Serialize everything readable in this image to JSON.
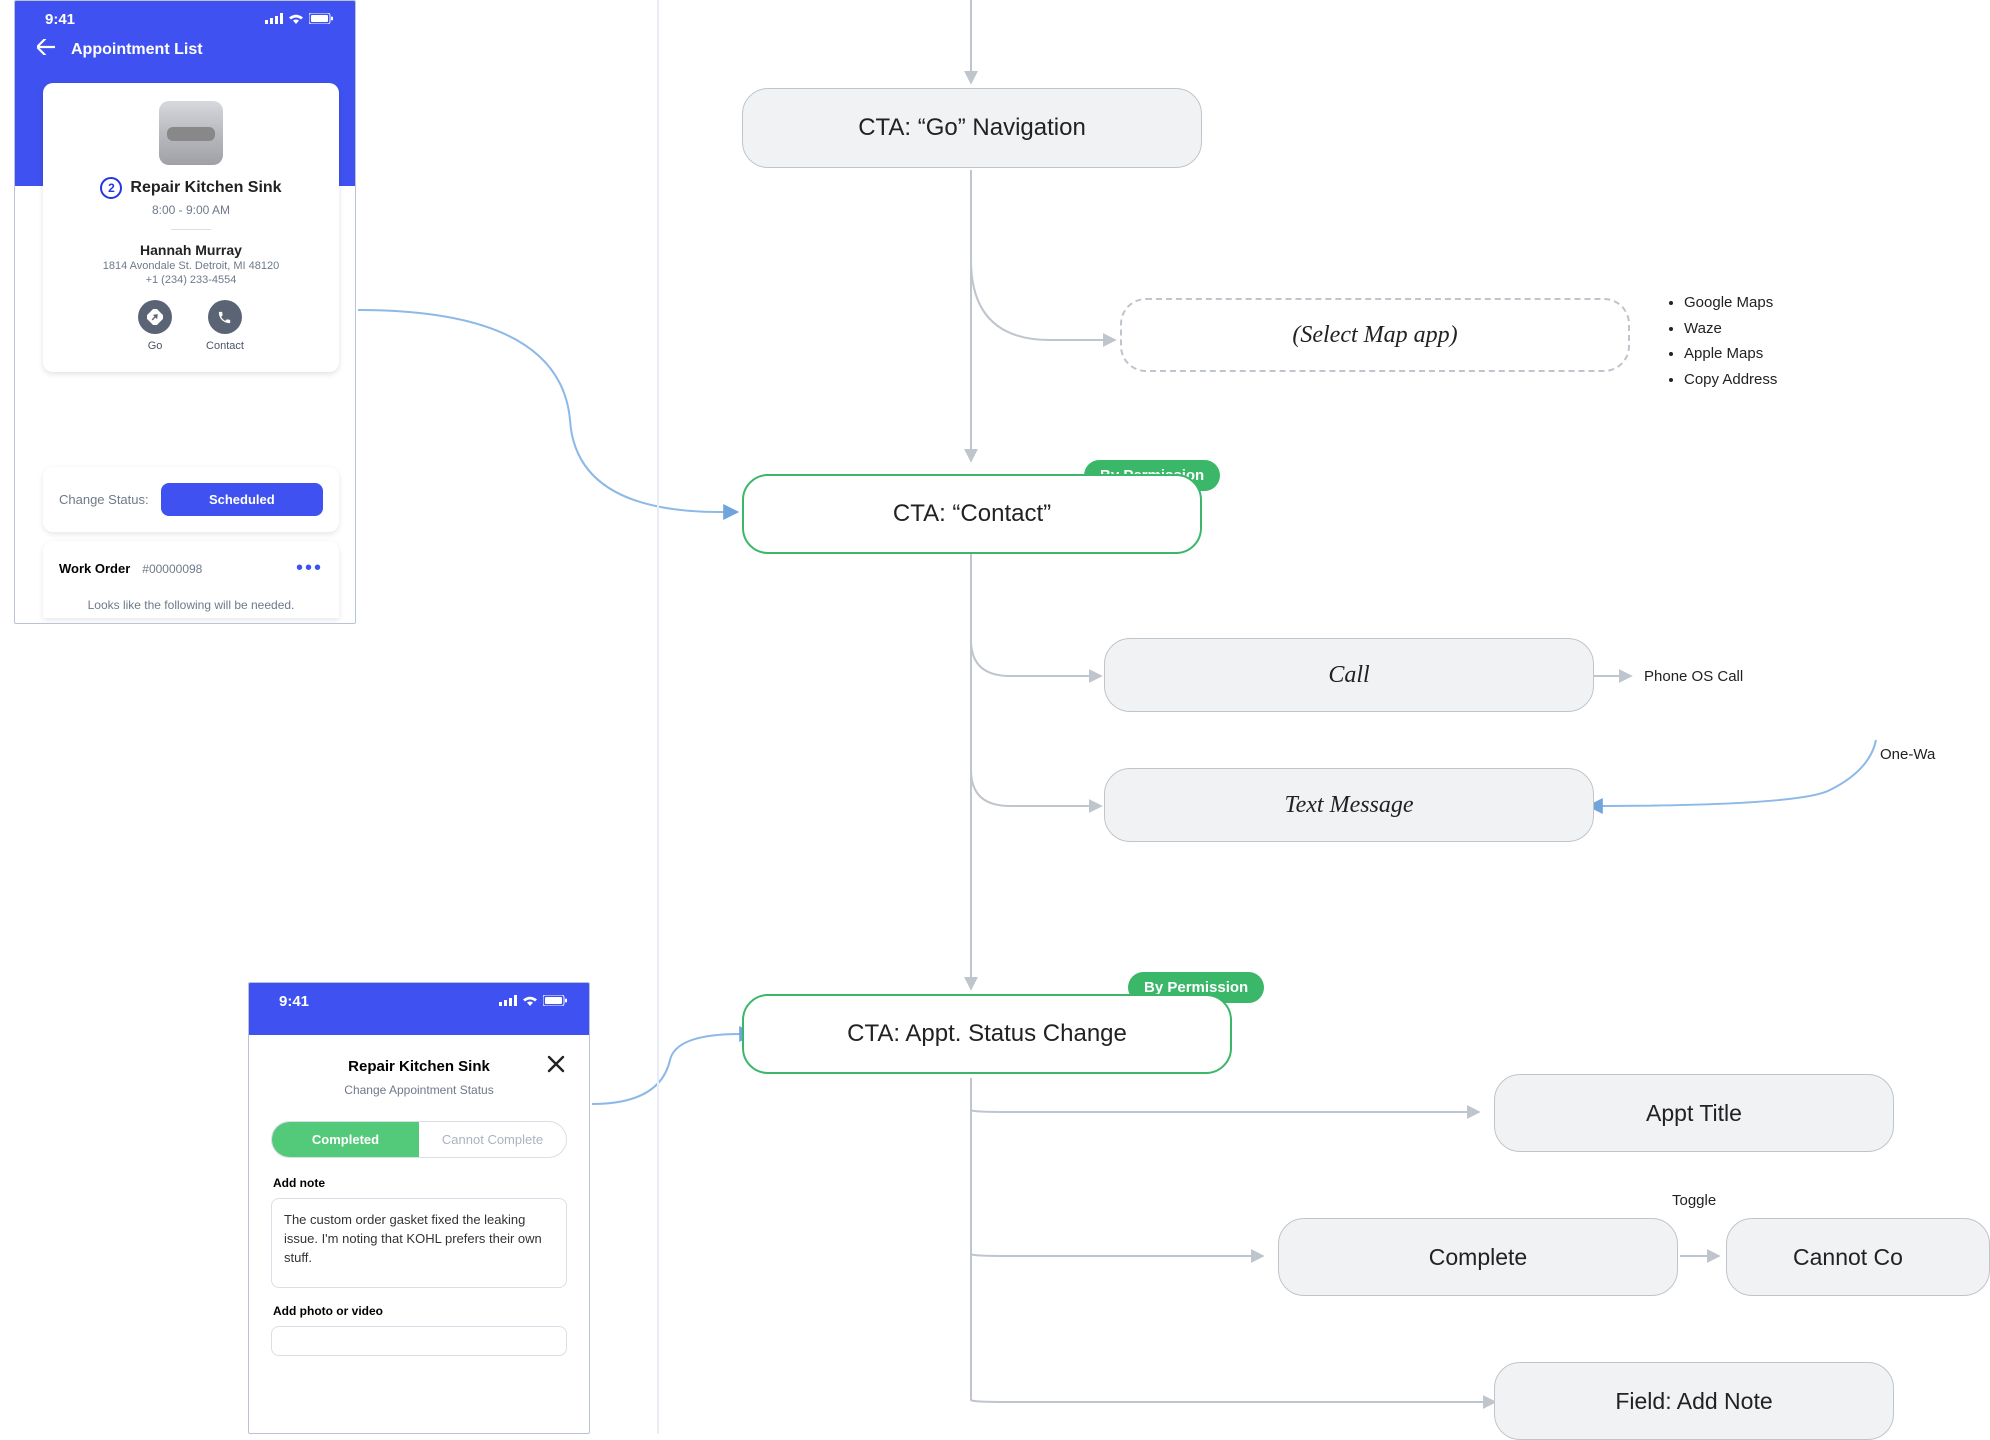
{
  "phone1": {
    "statusbar": {
      "time": "9:41"
    },
    "appbar": {
      "title": "Appointment List"
    },
    "appt": {
      "badge": "2",
      "title": "Repair Kitchen Sink",
      "time": "8:00 - 9:00 AM",
      "customer": "Hannah Murray",
      "address": "1814 Avondale St. Detroit, MI 48120",
      "phone": "+1 (234) 233-4554",
      "go_label": "Go",
      "contact_label": "Contact"
    },
    "status": {
      "label": "Change Status:",
      "value": "Scheduled"
    },
    "work_order": {
      "label": "Work Order",
      "number": "#00000098",
      "note": "Looks like the following will be needed."
    }
  },
  "phone2": {
    "statusbar": {
      "time": "9:41"
    },
    "title": "Repair Kitchen Sink",
    "subtitle": "Change Appointment Status",
    "segments": {
      "completed": "Completed",
      "cannot": "Cannot Complete"
    },
    "note_label": "Add note",
    "note_text": "The custom order gasket fixed the leaking issue. I'm noting that KOHL prefers their own stuff.",
    "media_label": "Add photo or video"
  },
  "nodes": {
    "go_nav": "CTA: “Go” Navigation",
    "select_map": "(Select Map app)",
    "contact": "CTA: “Contact”",
    "call": "Call",
    "text": "Text Message",
    "status_change": "CTA: Appt. Status Change",
    "appt_title": "Appt Title",
    "complete": "Complete",
    "cannot_complete": "Cannot Co",
    "add_note": "Field: Add Note",
    "permission": "By Permission",
    "toggle": "Toggle"
  },
  "lists": {
    "maps": [
      "Google Maps",
      "Waze",
      "Apple Maps",
      "Copy Address"
    ]
  },
  "labels": {
    "phone_os_call": "Phone OS Call",
    "one_way": "One-Wa"
  }
}
